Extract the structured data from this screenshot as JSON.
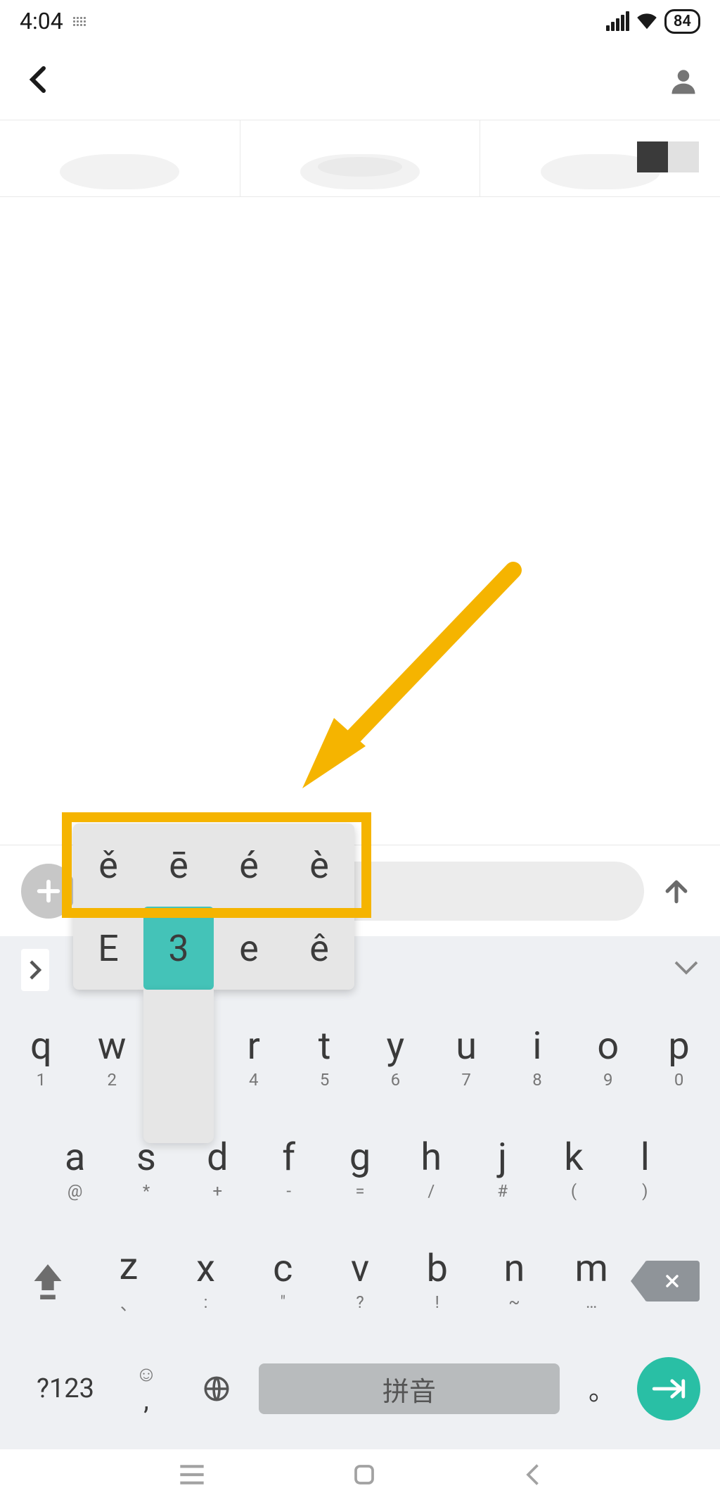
{
  "status": {
    "time": "4:04",
    "battery": "84"
  },
  "popup": {
    "row1": [
      "ě",
      "ē",
      "é",
      "è"
    ],
    "row2": [
      "E",
      "3",
      "e",
      "ê"
    ],
    "selected_index": 1
  },
  "keyboard": {
    "row1": [
      {
        "main": "q",
        "sub": "1"
      },
      {
        "main": "w",
        "sub": "2"
      },
      {
        "main": "e",
        "sub": "3"
      },
      {
        "main": "r",
        "sub": "4"
      },
      {
        "main": "t",
        "sub": "5"
      },
      {
        "main": "y",
        "sub": "6"
      },
      {
        "main": "u",
        "sub": "7"
      },
      {
        "main": "i",
        "sub": "8"
      },
      {
        "main": "o",
        "sub": "9"
      },
      {
        "main": "p",
        "sub": "0"
      }
    ],
    "row2": [
      {
        "main": "a",
        "sub": "@"
      },
      {
        "main": "s",
        "sub": "*"
      },
      {
        "main": "d",
        "sub": "+"
      },
      {
        "main": "f",
        "sub": "-"
      },
      {
        "main": "g",
        "sub": "="
      },
      {
        "main": "h",
        "sub": "/"
      },
      {
        "main": "j",
        "sub": "#"
      },
      {
        "main": "k",
        "sub": "("
      },
      {
        "main": "l",
        "sub": ")"
      }
    ],
    "row3": [
      {
        "main": "z",
        "sub": "、"
      },
      {
        "main": "x",
        "sub": ":"
      },
      {
        "main": "c",
        "sub": "\""
      },
      {
        "main": "v",
        "sub": "?"
      },
      {
        "main": "b",
        "sub": "!"
      },
      {
        "main": "n",
        "sub": "~"
      },
      {
        "main": "m",
        "sub": "…"
      }
    ],
    "numlabel": "?123",
    "emoji_sub": ",",
    "globe_sub": "",
    "space_label": "拼音",
    "period_main": "。",
    "period_sub": ""
  }
}
